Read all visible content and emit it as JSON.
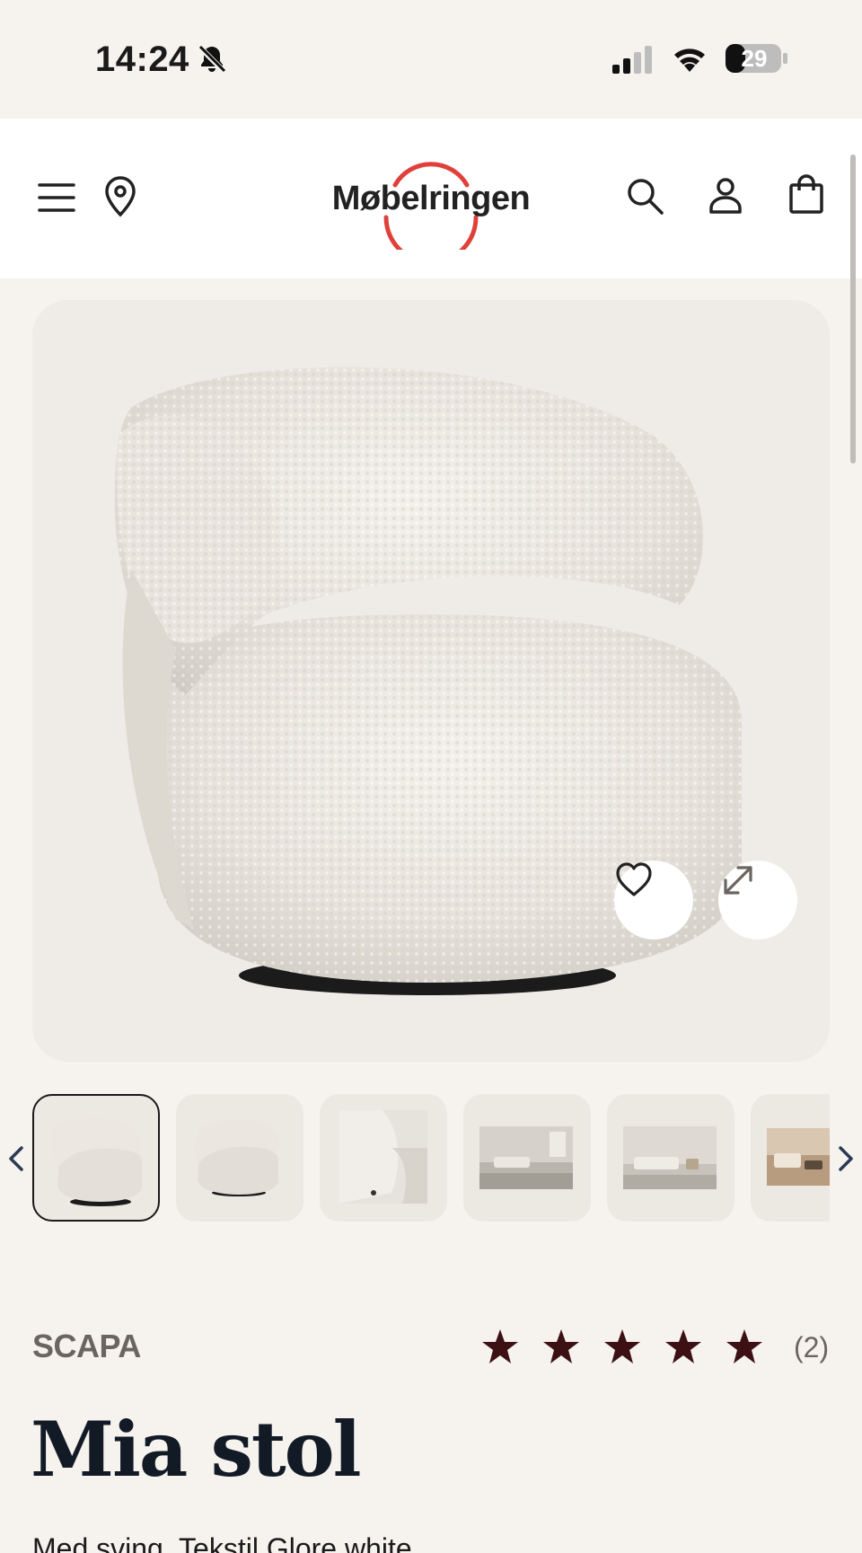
{
  "status_bar": {
    "time": "14:24",
    "battery_level": "29",
    "icons": [
      "bell-muted-icon",
      "cellular-signal-icon",
      "wifi-icon",
      "battery-icon"
    ]
  },
  "header": {
    "logo_text": "Møbelringen",
    "icons": [
      "menu-icon",
      "location-pin-icon",
      "search-icon",
      "account-icon",
      "shopping-bag-icon"
    ],
    "logo_ring_color": "#e0403a"
  },
  "gallery": {
    "main_image": "sheepskin-swivel-armchair",
    "actions": [
      "favorite-heart-icon",
      "expand-icon"
    ],
    "thumbnails": [
      {
        "name": "chair-front"
      },
      {
        "name": "chair-angle"
      },
      {
        "name": "chair-detail"
      },
      {
        "name": "room-scene-1"
      },
      {
        "name": "room-scene-2"
      },
      {
        "name": "room-scene-3"
      }
    ],
    "selected_index": 0
  },
  "product": {
    "brand": "SCAPA",
    "rating": 5,
    "rating_max": 5,
    "review_count": "(2)",
    "title": "Mia stol",
    "subtitle": "Med sving. Tekstil Glore white",
    "star_color": "#3d1014"
  }
}
